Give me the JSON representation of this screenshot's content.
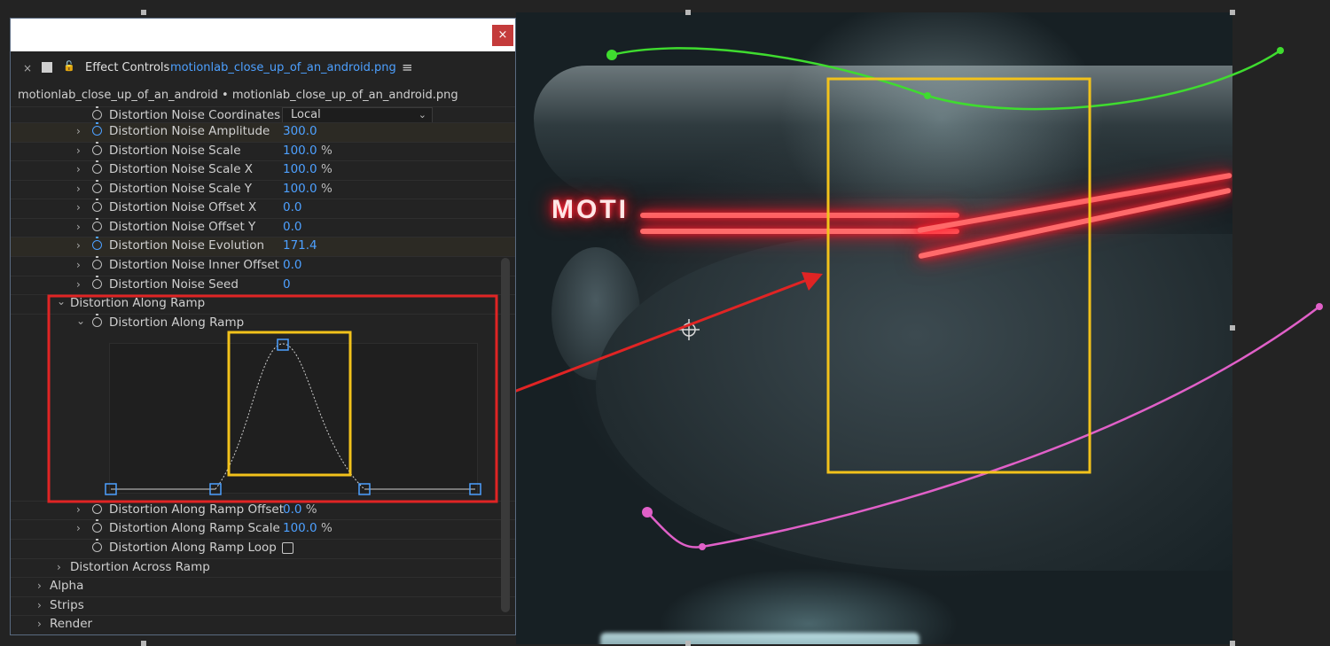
{
  "panel": {
    "close_symbol": "×",
    "tab_close_symbol": "×",
    "tab_title": "Effect Controls",
    "tab_file": "motionlab_close_up_of_an_android.png",
    "menu_symbol": "≡",
    "lock_symbol": "🔓",
    "layer_path": "motionlab_close_up_of_an_android • motionlab_close_up_of_an_android.png"
  },
  "properties": [
    {
      "label": "Distortion Noise Coordinates",
      "dropdown": "Local"
    },
    {
      "label": "Distortion Noise Amplitude",
      "value": "300.0",
      "unit": "",
      "keyframed": true
    },
    {
      "label": "Distortion Noise Scale",
      "value": "100.0",
      "unit": " %"
    },
    {
      "label": "Distortion Noise Scale X",
      "value": "100.0",
      "unit": " %"
    },
    {
      "label": "Distortion Noise Scale Y",
      "value": "100.0",
      "unit": " %"
    },
    {
      "label": "Distortion Noise Offset X",
      "value": "0.0",
      "unit": ""
    },
    {
      "label": "Distortion Noise Offset Y",
      "value": "0.0",
      "unit": ""
    },
    {
      "label": "Distortion Noise Evolution",
      "value": "171.4",
      "unit": "",
      "keyframed": true
    },
    {
      "label": "Distortion Noise Inner Offset",
      "value": "0.0",
      "unit": ""
    },
    {
      "label": "Distortion Noise Seed",
      "value": "0",
      "unit": ""
    }
  ],
  "ramp_group": {
    "group_label": "Distortion Along Ramp",
    "sub_label": "Distortion Along Ramp"
  },
  "ramp_props": [
    {
      "label": "Distortion Along Ramp Offset",
      "value": "0.0",
      "unit": " %"
    },
    {
      "label": "Distortion Along Ramp Scale",
      "value": "100.0",
      "unit": " %"
    },
    {
      "label": "Distortion Along Ramp Loop"
    }
  ],
  "groups": {
    "across_ramp": "Distortion Across Ramp",
    "alpha": "Alpha",
    "strips": "Strips",
    "render": "Render"
  },
  "comp": {
    "overlay_text": "MOTI"
  },
  "colors": {
    "accent_blue": "#4da0ff",
    "highlight_red": "#e02424",
    "highlight_yellow": "#f2c21b",
    "path_green": "#3fdc2f",
    "path_pink": "#e060c8"
  },
  "icons": {
    "chevron_right": "›",
    "chevron_down": "⌄",
    "dropdown_arrow": "⌄",
    "anchor": "⌖"
  }
}
